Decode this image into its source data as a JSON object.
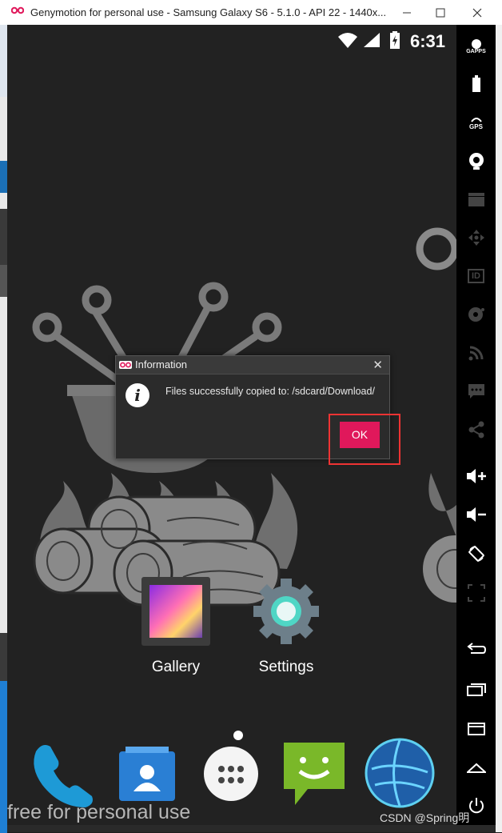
{
  "window": {
    "title": "Genymotion for personal use - Samsung Galaxy S6 - 5.1.0 - API 22 - 1440x...",
    "minimize_glyph": "—",
    "maximize_glyph": "☐",
    "close_glyph": "✕"
  },
  "status_bar": {
    "time": "6:31"
  },
  "toolbar": {
    "gapps_label": "GAPPS",
    "gps_label": "GPS",
    "id_label": "ID"
  },
  "dialog": {
    "title": "Information",
    "message": "Files successfully copied to: /sdcard/Download/",
    "ok_label": "OK",
    "close_glyph": "✕"
  },
  "home": {
    "apps": [
      {
        "label": "Gallery",
        "icon": "gallery-icon"
      },
      {
        "label": "Settings",
        "icon": "settings-icon"
      }
    ],
    "dock": [
      "phone-icon",
      "contacts-icon",
      "app-drawer-icon",
      "messaging-icon",
      "browser-icon"
    ]
  },
  "watermark": "free for personal use",
  "credit": "CSDN @Spring明"
}
